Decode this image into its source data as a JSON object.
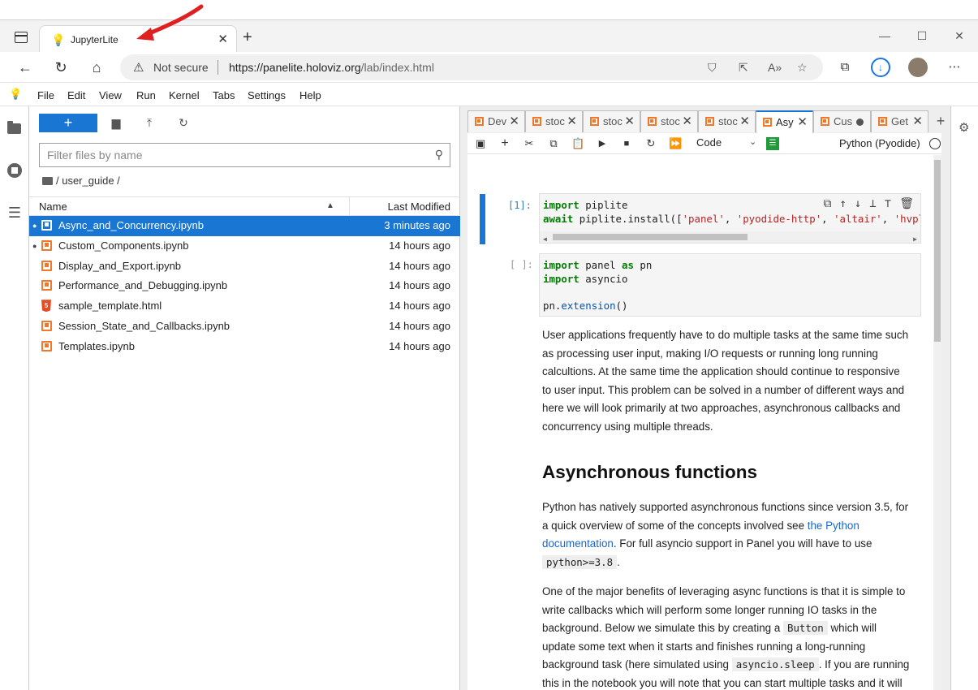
{
  "browser": {
    "tab_title": "JupyterLite",
    "security_label": "Not secure",
    "url_host": "https://panelite.holoviz.org",
    "url_path": "/lab/index.html"
  },
  "menubar": {
    "items": [
      "File",
      "Edit",
      "View",
      "Run",
      "Kernel",
      "Tabs",
      "Settings",
      "Help"
    ]
  },
  "filebrowser": {
    "new_label": "+",
    "filter_placeholder": "Filter files by name",
    "breadcrumb": "/ user_guide /",
    "header": {
      "name": "Name",
      "modified": "Last Modified"
    },
    "files": [
      {
        "name": "Async_and_Concurrency.ipynb",
        "modified": "3 minutes ago",
        "type": "notebook",
        "running": true,
        "selected": true
      },
      {
        "name": "Custom_Components.ipynb",
        "modified": "14 hours ago",
        "type": "notebook",
        "running": true,
        "selected": false
      },
      {
        "name": "Display_and_Export.ipynb",
        "modified": "14 hours ago",
        "type": "notebook",
        "running": false,
        "selected": false
      },
      {
        "name": "Performance_and_Debugging.ipynb",
        "modified": "14 hours ago",
        "type": "notebook",
        "running": false,
        "selected": false
      },
      {
        "name": "sample_template.html",
        "modified": "14 hours ago",
        "type": "html",
        "running": false,
        "selected": false
      },
      {
        "name": "Session_State_and_Callbacks.ipynb",
        "modified": "14 hours ago",
        "type": "notebook",
        "running": false,
        "selected": false
      },
      {
        "name": "Templates.ipynb",
        "modified": "14 hours ago",
        "type": "notebook",
        "running": false,
        "selected": false
      }
    ]
  },
  "dock_tabs": [
    {
      "label": "Dev",
      "state": "close"
    },
    {
      "label": "stoc",
      "state": "close"
    },
    {
      "label": "stoc",
      "state": "close"
    },
    {
      "label": "stoc",
      "state": "close"
    },
    {
      "label": "stoc",
      "state": "close"
    },
    {
      "label": "Asy",
      "state": "close",
      "active": true
    },
    {
      "label": "Cus",
      "state": "dirty"
    },
    {
      "label": "Get",
      "state": "close"
    }
  ],
  "notebook": {
    "cell_type": "Code",
    "kernel_name": "Python (Pyodide)",
    "cell1_prompt": "[1]:",
    "cell2_prompt": "[ ]:",
    "md_p1": "User applications frequently have to do multiple tasks at the same time such as processing user input, making I/O requests or running long running calcultions. At the same time the application should continue to responsive to user input. This problem can be solved in a number of different ways and here we will look primarily at two approaches, asynchronous callbacks and concurrency using multiple threads.",
    "md_h2": "Asynchronous functions",
    "md_p2_a": "Python has natively supported asynchronous functions since version 3.5, for a quick overview of some of the concepts involved see ",
    "md_p2_link": "the Python documentation",
    "md_p2_b": ". For full asyncio support in Panel you will have to use ",
    "md_p2_code": "python>=3.8",
    "md_p2_c": ".",
    "md_p3_a": "One of the major benefits of leveraging async functions is that it is simple to write callbacks which will perform some longer running IO tasks in the background. Below we simulate this by creating a ",
    "md_p3_code1": "Button",
    "md_p3_b": " which will update some text when it starts and finishes running a long-running background task (here simulated using ",
    "md_p3_code2": "asyncio.sleep",
    "md_p3_c": ". If you are running this in the notebook you will note that you can start multiple tasks and it will update the text immediately but continue in the background."
  },
  "colors": {
    "accent": "#1976d2",
    "notebook_orange": "#f37726",
    "arrow_red": "#e02020"
  }
}
